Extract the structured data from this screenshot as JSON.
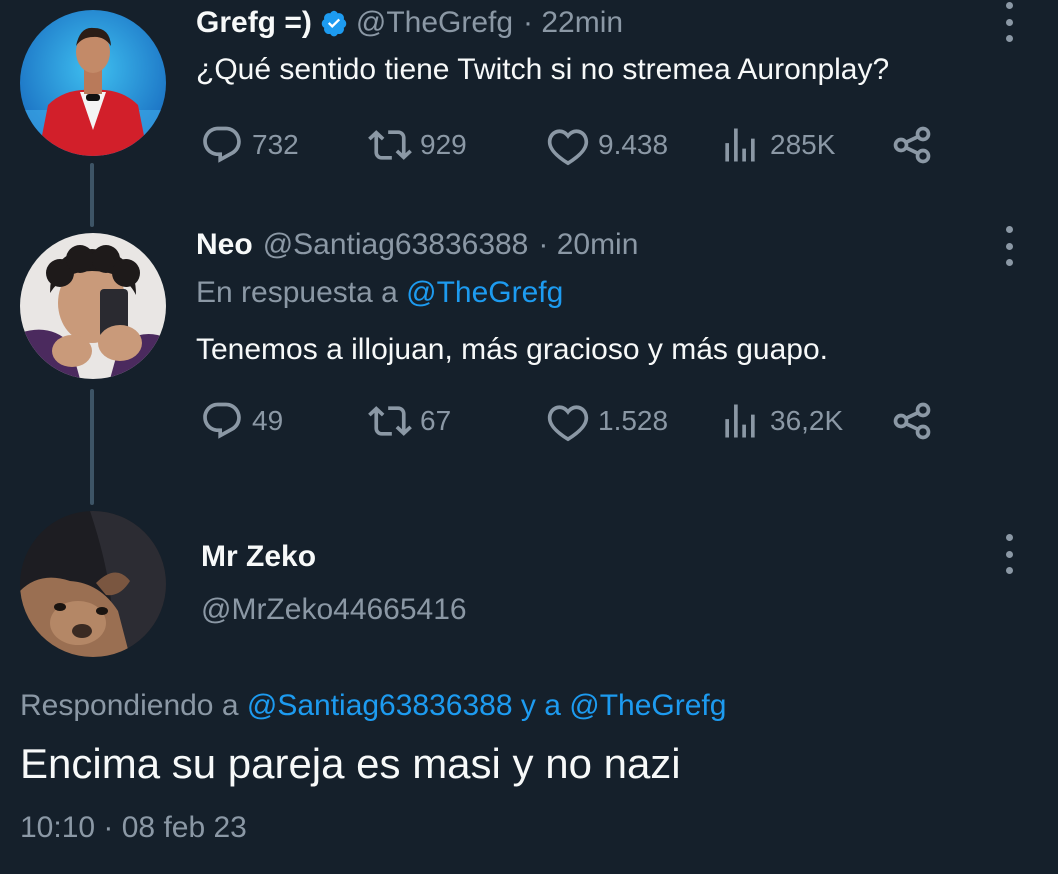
{
  "tweets": [
    {
      "name": "Grefg =)",
      "handle": "@TheGrefg",
      "time": "· 22min",
      "text": "¿Qué sentido tiene Twitch si no stremea Auronplay?",
      "replies": "732",
      "retweets": "929",
      "likes": "9.438",
      "views": "285K"
    },
    {
      "name": "Neo",
      "handle": "@Santiag63836388",
      "time": "· 20min",
      "reply_prefix": "En respuesta a",
      "reply_user": "@TheGrefg",
      "text": "Tenemos a illojuan, más gracioso y más guapo.",
      "replies": "49",
      "retweets": "67",
      "likes": "1.528",
      "views": "36,2K"
    }
  ],
  "focused": {
    "name": "Mr Zeko",
    "handle": "@MrZeko44665416",
    "reply_prefix": "Respondiendo a",
    "reply_user1": "@Santiag63836388",
    "reply_conj": "y a",
    "reply_user2": "@TheGrefg",
    "text": "Encima su pareja es masi y no nazi",
    "timestamp": "10:10 · 08 feb 23"
  },
  "colors": {
    "background": "#15202b",
    "text": "#f7f9f9",
    "muted": "#8b98a5",
    "link": "#1d9bf0",
    "verified": "#1d9bf0",
    "thread_line": "#3d5466"
  },
  "icons": [
    "reply-icon",
    "retweet-icon",
    "like-icon",
    "views-icon",
    "share-icon",
    "verified-icon",
    "more-icon"
  ]
}
